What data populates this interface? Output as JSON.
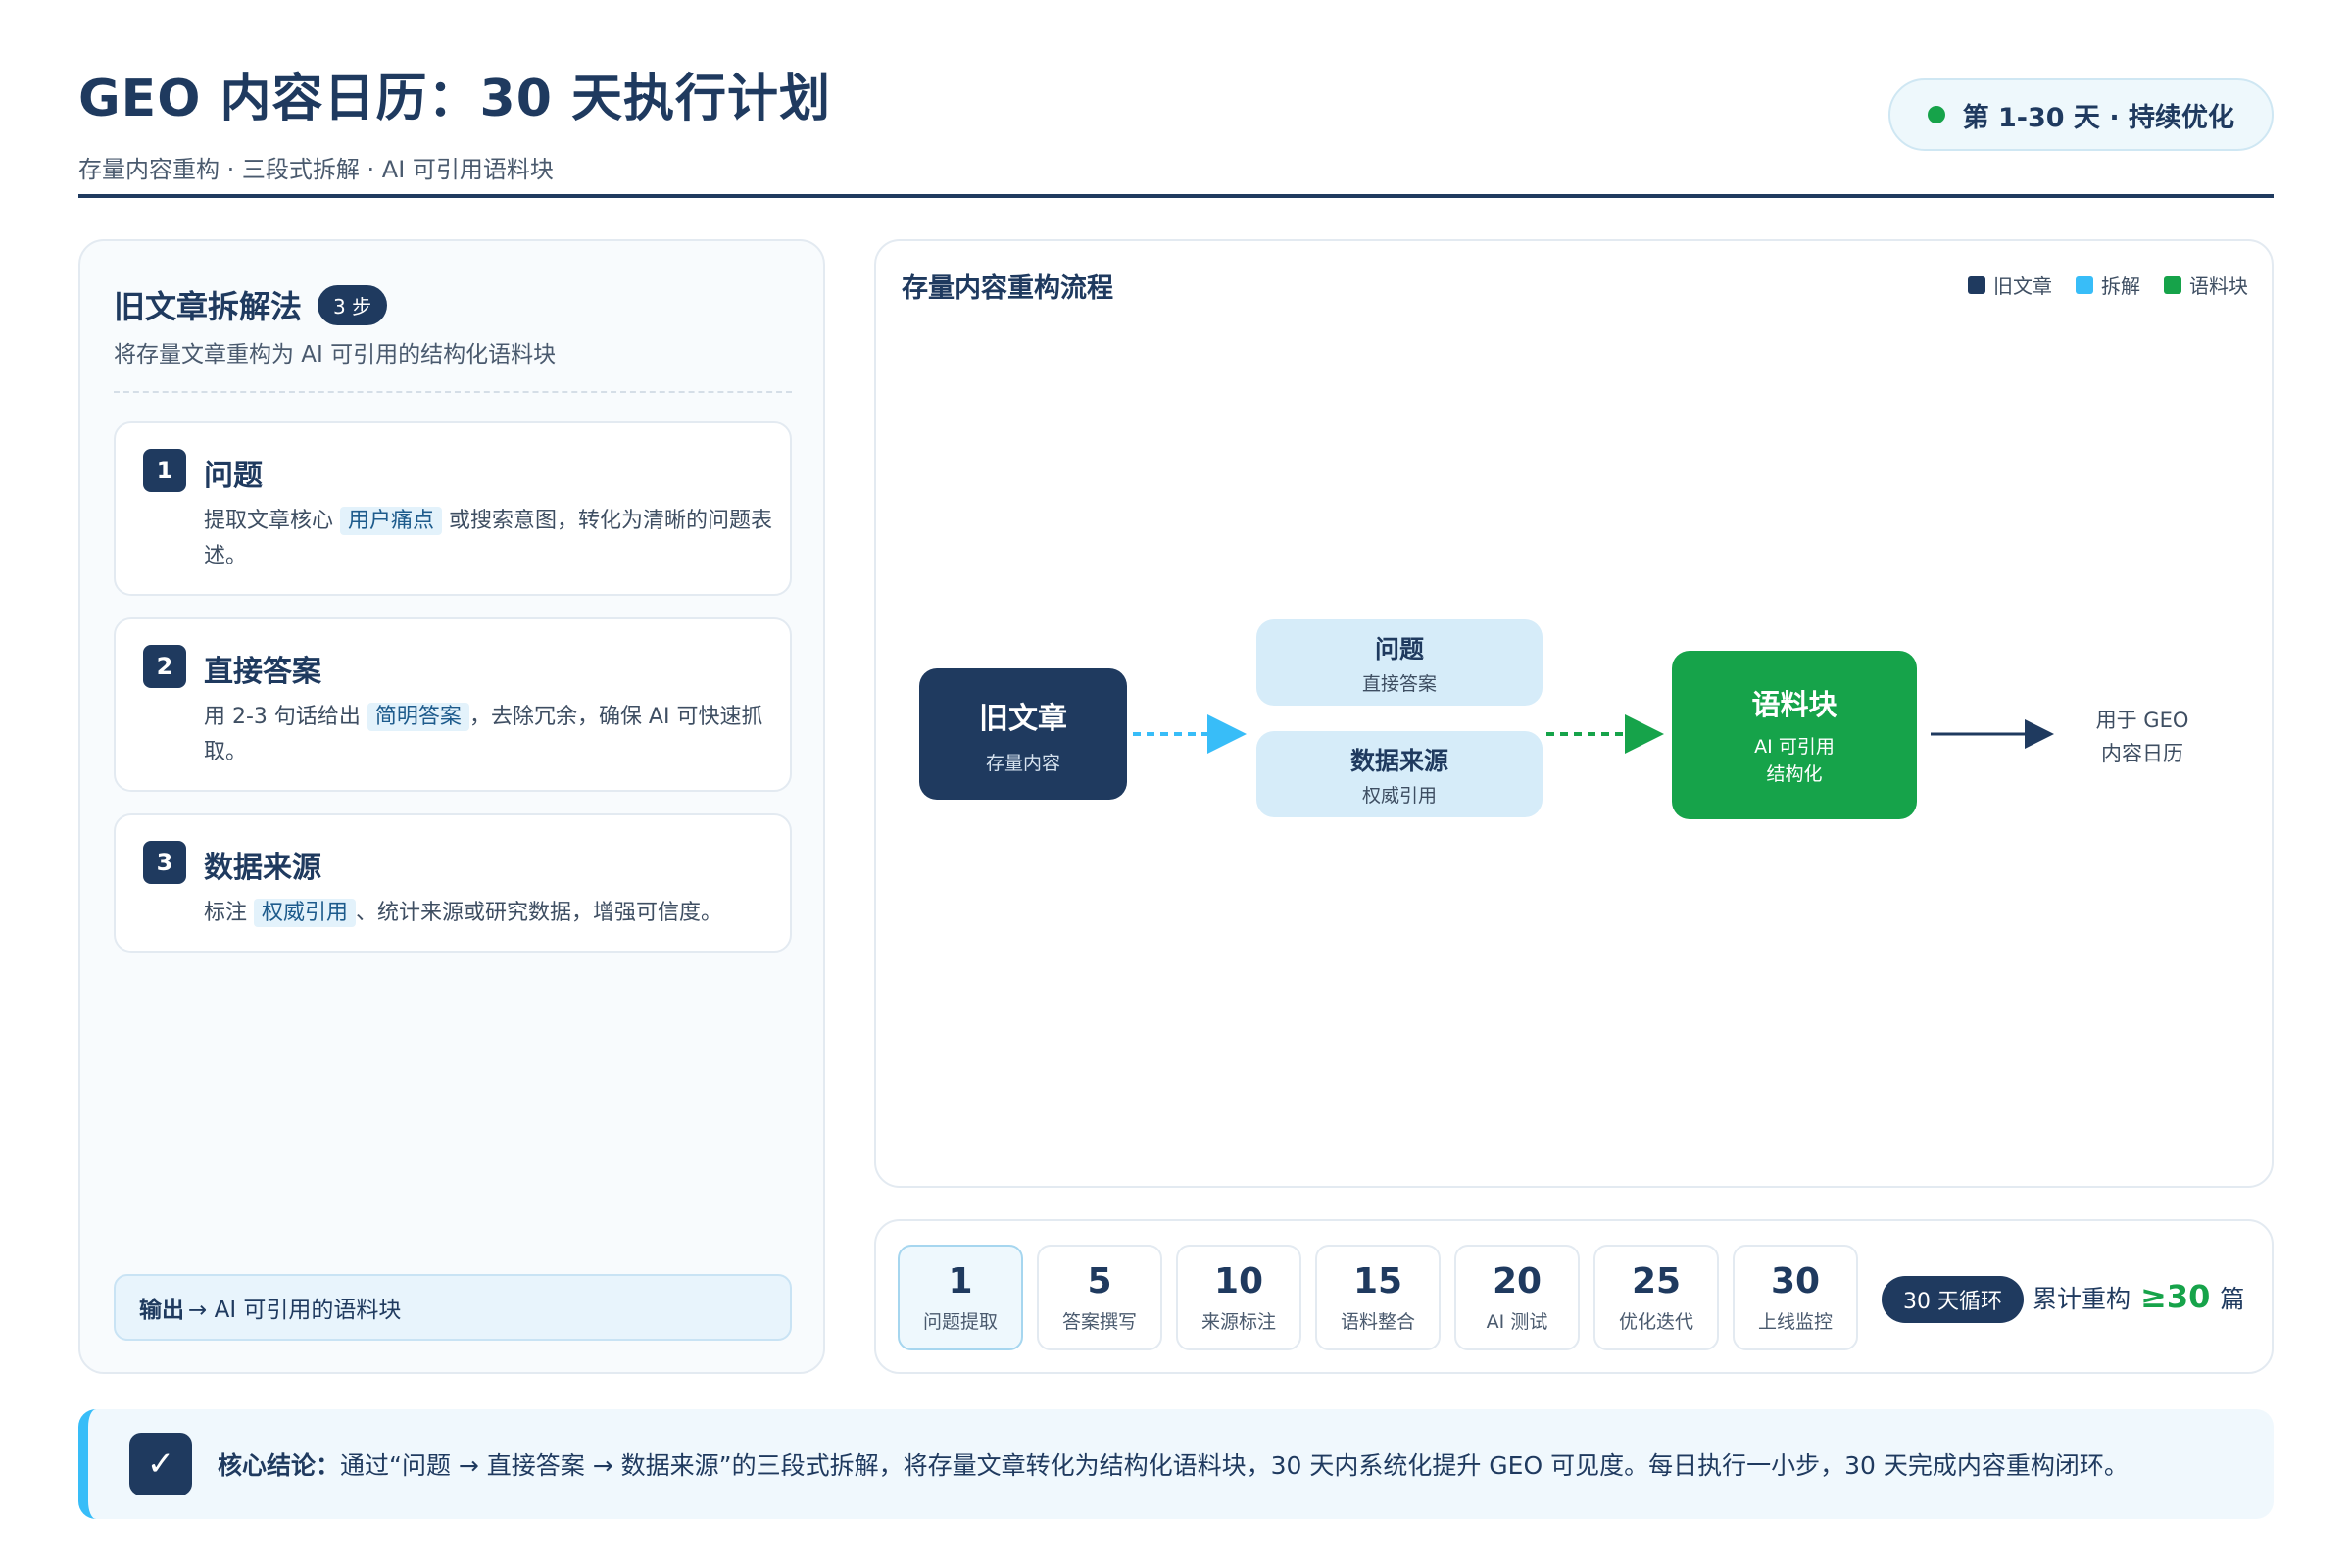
{
  "header": {
    "title": "GEO 内容日历：30 天执行计划",
    "subtitle": "存量内容重构 · 三段式拆解 · AI 可引用语料块",
    "period_badge": "第 1-30 天 · 持续优化"
  },
  "left_panel": {
    "title": "旧文章拆解法",
    "badge": "3 步",
    "description": "将存量文章重构为 AI 可引用的结构化语料块",
    "steps": [
      {
        "number": "1",
        "title": "问题",
        "text_before": "提取文章核心 ",
        "highlight": "用户痛点",
        "text_after": " 或搜索意图，转化为清晰的问题表述。"
      },
      {
        "number": "2",
        "title": "直接答案",
        "text_before": "用 2-3 句话给出 ",
        "highlight": "简明答案",
        "text_after": "，去除冗余，确保 AI 可快速抓取。"
      },
      {
        "number": "3",
        "title": "数据来源",
        "text_before": "标注 ",
        "highlight": "权威引用",
        "text_after": "、统计来源或研究数据，增强可信度。"
      }
    ],
    "output_label": "输出",
    "output_text": "→ AI 可引用的语料块"
  },
  "flow": {
    "title": "存量内容重构流程",
    "legend": [
      {
        "label": "旧文章",
        "color": "#1f3a5f"
      },
      {
        "label": "拆解",
        "color": "#38bdf8"
      },
      {
        "label": "语料块",
        "color": "#16a34a"
      }
    ],
    "old_article": {
      "title": "旧文章",
      "sub": "存量内容"
    },
    "question": {
      "title": "问题",
      "sub": "直接答案"
    },
    "data_source": {
      "title": "数据来源",
      "sub": "权威引用"
    },
    "corpus": {
      "title": "语料块",
      "sub_line1": "AI 可引用",
      "sub_line2": "结构化"
    },
    "end_line1": "用于 GEO",
    "end_line2": "内容日历"
  },
  "timeline": {
    "days": [
      {
        "day": "1",
        "label": "问题提取",
        "active": true
      },
      {
        "day": "5",
        "label": "答案撰写",
        "active": false
      },
      {
        "day": "10",
        "label": "来源标注",
        "active": false
      },
      {
        "day": "15",
        "label": "语料整合",
        "active": false
      },
      {
        "day": "20",
        "label": "AI 测试",
        "active": false
      },
      {
        "day": "25",
        "label": "优化迭代",
        "active": false
      },
      {
        "day": "30",
        "label": "上线监控",
        "active": false
      }
    ],
    "cycle_badge": "30 天循环",
    "cumulative_label": "累计重构",
    "cumulative_value": "≥30",
    "cumulative_unit": "篇"
  },
  "conclusion": {
    "icon": "✓",
    "label": "核心结论：",
    "text": "通过“问题 → 直接答案 → 数据来源”的三段式拆解，将存量文章转化为结构化语料块，30 天内系统化提升 GEO 可见度。每日执行一小步，30 天完成内容重构闭环。"
  },
  "colors": {
    "navy": "#1f3a5f",
    "sky": "#38bdf8",
    "green": "#16a34a",
    "light_blue": "#d6ecf9"
  }
}
